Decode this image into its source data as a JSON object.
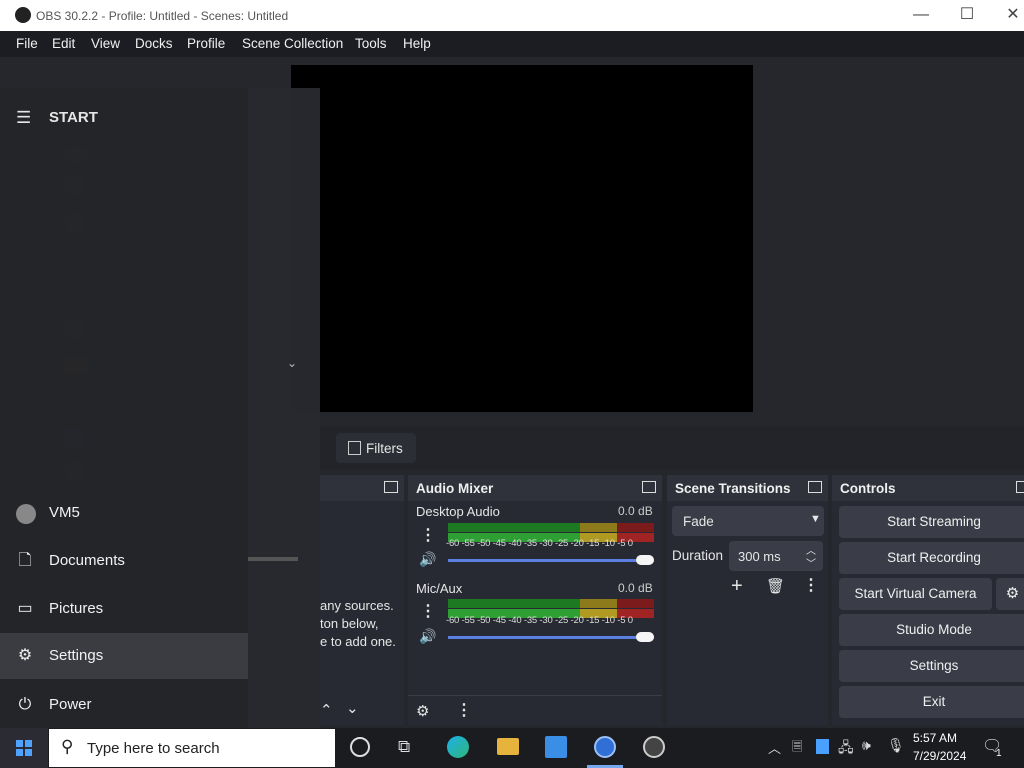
{
  "window": {
    "title": "OBS 30.2.2 - Profile: Untitled - Scenes: Untitled",
    "controls": {
      "minimize": "—",
      "maximize": "☐",
      "close": "✕"
    }
  },
  "menu": [
    "File",
    "Edit",
    "View",
    "Docks",
    "Profile",
    "Scene Collection",
    "Tools",
    "Help"
  ],
  "toolbar": {
    "filters_label": "Filters"
  },
  "sources_hint": [
    "any sources.",
    "ton below,",
    "e to add one."
  ],
  "audio_mixer": {
    "title": "Audio Mixer",
    "channels": [
      {
        "name": "Desktop Audio",
        "level": "0.0 dB",
        "volume_pct": 100
      },
      {
        "name": "Mic/Aux",
        "level": "0.0 dB",
        "volume_pct": 100
      }
    ],
    "scale": "-60 -55 -50 -45 -40 -35 -30 -25 -20 -15 -10  -5   0"
  },
  "scene_transitions": {
    "title": "Scene Transitions",
    "transition": "Fade",
    "duration_label": "Duration",
    "duration_value": "300 ms"
  },
  "controls": {
    "title": "Controls",
    "buttons": [
      "Start Streaming",
      "Start Recording",
      "Start Virtual Camera",
      "Studio Mode",
      "Settings",
      "Exit"
    ]
  },
  "start_menu": {
    "title": "START",
    "user": "VM5",
    "items": [
      "Documents",
      "Pictures",
      "Settings",
      "Power"
    ]
  },
  "taskbar": {
    "search_placeholder": "Type here to search",
    "time": "5:57 AM",
    "date": "7/29/2024",
    "notification_count": "1"
  },
  "colors": {
    "accent_blue": "#5a7fe0",
    "meter_green": "#2ea033",
    "meter_yellow": "#b09a22",
    "meter_red": "#a02424",
    "button_bg": "#3a3d48"
  }
}
